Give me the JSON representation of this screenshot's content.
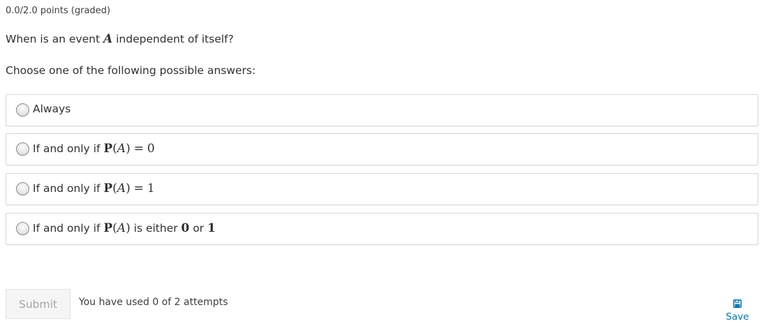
{
  "problem": {
    "points": "0.0/2.0 points (graded)",
    "question_pre": "When is an event",
    "question_var": "A",
    "question_post": "independent of itself?",
    "instructions": "Choose one of the following possible answers:"
  },
  "options": [
    {
      "label": "Always"
    },
    {
      "prefix": "If and only if",
      "prob": "P",
      "lp": "(",
      "var": "A",
      "rp": ")",
      "rel": "=",
      "val": "0"
    },
    {
      "prefix": "If and only if",
      "prob": "P",
      "lp": "(",
      "var": "A",
      "rp": ")",
      "rel": "=",
      "val": "1"
    },
    {
      "prefix": "If and only if",
      "prob": "P",
      "lp": "(",
      "var": "A",
      "rp": ")",
      "mid": "is either",
      "v1": "0",
      "or": "or",
      "v2": "1"
    }
  ],
  "actions": {
    "submit_label": "Submit",
    "attempts": "You have used 0 of 2 attempts",
    "save_label": "Save",
    "save_icon": "floppy-disk-icon"
  },
  "colors": {
    "accent": "#0075b4",
    "border": "#d7d7d7",
    "text": "#313131"
  }
}
